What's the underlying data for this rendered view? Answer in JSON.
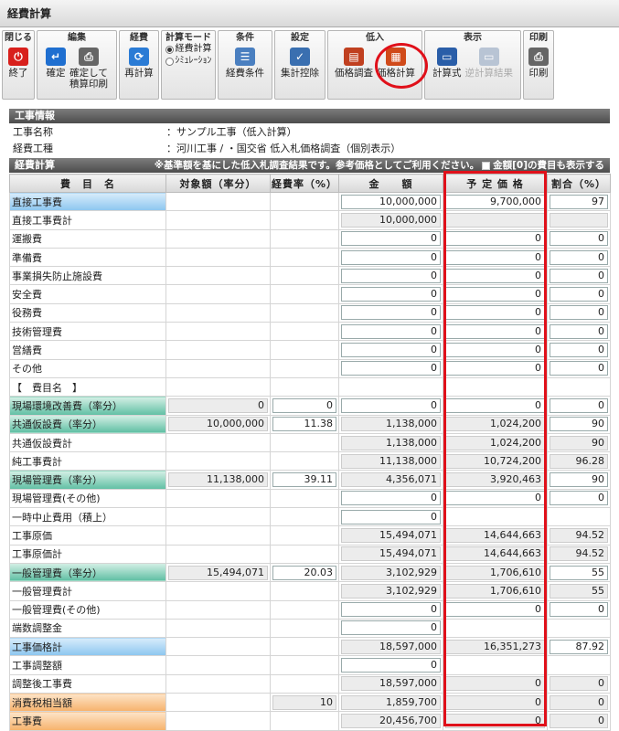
{
  "window": {
    "title": "経費計算"
  },
  "toolbar": {
    "groups": [
      {
        "id": "close",
        "title": "閉じる",
        "buttons": [
          {
            "id": "exit",
            "label": "終了",
            "icon": "power-icon",
            "color": "#d8201c",
            "enabled": true
          }
        ]
      },
      {
        "id": "edit",
        "title": "編集",
        "buttons": [
          {
            "id": "confirm",
            "label": "確定",
            "icon": "enter-arrow-icon",
            "color": "#1f6fd0",
            "enabled": true
          },
          {
            "id": "confirm-print",
            "label": "確定して\n積算印刷",
            "icon": "printer-icon",
            "color": "#666666",
            "enabled": true
          }
        ]
      },
      {
        "id": "expense",
        "title": "経費",
        "buttons": [
          {
            "id": "recalc",
            "label": "再計算",
            "icon": "refresh-icon",
            "color": "#2a7bd5",
            "enabled": true
          }
        ]
      },
      {
        "id": "mode",
        "title": "計算モード",
        "radios": [
          {
            "id": "mode-calc",
            "label": "経費計算",
            "selected": true
          },
          {
            "id": "mode-sim",
            "label": "ｼﾐｭﾚｰｼｮﾝ",
            "selected": false
          }
        ]
      },
      {
        "id": "conditions",
        "title": "条件",
        "buttons": [
          {
            "id": "expense-conditions",
            "label": "経費条件",
            "icon": "list-icon",
            "color": "#4a7fc0",
            "enabled": true
          }
        ]
      },
      {
        "id": "settings",
        "title": "設定",
        "buttons": [
          {
            "id": "aggregation-deduction",
            "label": "集計控除",
            "icon": "calendar-check-icon",
            "color": "#3a6fb0",
            "enabled": true
          }
        ]
      },
      {
        "id": "low-bid",
        "title": "低入",
        "buttons": [
          {
            "id": "price-survey",
            "label": "価格調査",
            "icon": "book-icon",
            "color": "#c04020",
            "enabled": true
          },
          {
            "id": "price-calc",
            "label": "価格計算",
            "icon": "calculator-icon",
            "color": "#d04a1a",
            "enabled": true
          }
        ]
      },
      {
        "id": "display",
        "title": "表示",
        "buttons": [
          {
            "id": "formula",
            "label": "計算式",
            "icon": "window-icon",
            "color": "#2a5ea8",
            "enabled": true
          },
          {
            "id": "reverse-result",
            "label": "逆計算結果",
            "icon": "window-icon",
            "color": "#b8c4d4",
            "enabled": false
          }
        ]
      },
      {
        "id": "print",
        "title": "印刷",
        "buttons": [
          {
            "id": "print",
            "label": "印刷",
            "icon": "printer-icon",
            "color": "#666666",
            "enabled": true
          }
        ]
      }
    ]
  },
  "info": {
    "section_title": "工事情報",
    "rows": [
      {
        "label": "工事名称",
        "value": "：サンプル工事（低入計算）"
      },
      {
        "label": "経費工種",
        "value": "：河川工事 / ・国交省 低入札価格調査（個別表示）"
      }
    ]
  },
  "calc": {
    "section_title": "経費計算",
    "note": "※基準額を基にした低入札調査結果です。参考価格としてご利用ください。",
    "checkbox_label": "金額[0]の費目も表示する",
    "headers": [
      "費　目　名",
      "対象額（率分）",
      "経費率（%）",
      "金　　額",
      "予 定 価 格",
      "割合（%）"
    ],
    "rows": [
      {
        "name": "直接工事費",
        "color": "blue",
        "target": "",
        "rate": "",
        "amount": "10,000,000",
        "amount_ro": false,
        "planned": "9,700,000",
        "planned_ro": false,
        "ratio": "97",
        "ratio_ro": false
      },
      {
        "name": "直接工事費計",
        "color": "",
        "target": "",
        "rate": "",
        "amount": "10,000,000",
        "amount_ro": true,
        "planned": "",
        "planned_ro": true,
        "ratio": "",
        "ratio_ro": true
      },
      {
        "name": "運搬費",
        "color": "",
        "target": "",
        "rate": "",
        "amount": "0",
        "amount_ro": false,
        "planned": "0",
        "planned_ro": false,
        "ratio": "0",
        "ratio_ro": false
      },
      {
        "name": "準備費",
        "color": "",
        "target": "",
        "rate": "",
        "amount": "0",
        "amount_ro": false,
        "planned": "0",
        "planned_ro": false,
        "ratio": "0",
        "ratio_ro": false
      },
      {
        "name": "事業損失防止施設費",
        "color": "",
        "target": "",
        "rate": "",
        "amount": "0",
        "amount_ro": false,
        "planned": "0",
        "planned_ro": false,
        "ratio": "0",
        "ratio_ro": false
      },
      {
        "name": "安全費",
        "color": "",
        "target": "",
        "rate": "",
        "amount": "0",
        "amount_ro": false,
        "planned": "0",
        "planned_ro": false,
        "ratio": "0",
        "ratio_ro": false
      },
      {
        "name": "役務費",
        "color": "",
        "target": "",
        "rate": "",
        "amount": "0",
        "amount_ro": false,
        "planned": "0",
        "planned_ro": false,
        "ratio": "0",
        "ratio_ro": false
      },
      {
        "name": "技術管理費",
        "color": "",
        "target": "",
        "rate": "",
        "amount": "0",
        "amount_ro": false,
        "planned": "0",
        "planned_ro": false,
        "ratio": "0",
        "ratio_ro": false
      },
      {
        "name": "営繕費",
        "color": "",
        "target": "",
        "rate": "",
        "amount": "0",
        "amount_ro": false,
        "planned": "0",
        "planned_ro": false,
        "ratio": "0",
        "ratio_ro": false
      },
      {
        "name": "その他",
        "color": "",
        "target": "",
        "rate": "",
        "amount": "0",
        "amount_ro": false,
        "planned": "0",
        "planned_ro": false,
        "ratio": "0",
        "ratio_ro": false
      },
      {
        "name": "【　費目名　】",
        "color": "",
        "target": "",
        "rate": "",
        "amount": "",
        "amount_ro": null,
        "planned": "",
        "planned_ro": null,
        "ratio": "",
        "ratio_ro": null
      },
      {
        "name": "現場環境改善費（率分）",
        "color": "teal",
        "target": "0",
        "target_ro": true,
        "rate": "0",
        "rate_ro": false,
        "amount": "0",
        "amount_ro": false,
        "planned": "0",
        "planned_ro": false,
        "ratio": "0",
        "ratio_ro": false
      },
      {
        "name": "共通仮設費（率分）",
        "color": "teal",
        "target": "10,000,000",
        "target_ro": true,
        "rate": "11.38",
        "rate_ro": false,
        "amount": "1,138,000",
        "amount_ro": true,
        "planned": "1,024,200",
        "planned_ro": true,
        "ratio": "90",
        "ratio_ro": false
      },
      {
        "name": "共通仮設費計",
        "color": "",
        "target": "",
        "rate": "",
        "amount": "1,138,000",
        "amount_ro": true,
        "planned": "1,024,200",
        "planned_ro": true,
        "ratio": "90",
        "ratio_ro": true
      },
      {
        "name": "純工事費計",
        "color": "",
        "target": "",
        "rate": "",
        "amount": "11,138,000",
        "amount_ro": true,
        "planned": "10,724,200",
        "planned_ro": true,
        "ratio": "96.28",
        "ratio_ro": true
      },
      {
        "name": "現場管理費（率分）",
        "color": "teal",
        "target": "11,138,000",
        "target_ro": true,
        "rate": "39.11",
        "rate_ro": false,
        "amount": "4,356,071",
        "amount_ro": true,
        "planned": "3,920,463",
        "planned_ro": true,
        "ratio": "90",
        "ratio_ro": false
      },
      {
        "name": "現場管理費(その他)",
        "color": "",
        "target": "",
        "rate": "",
        "amount": "0",
        "amount_ro": false,
        "planned": "0",
        "planned_ro": false,
        "ratio": "0",
        "ratio_ro": false
      },
      {
        "name": "一時中止費用（積上）",
        "color": "",
        "target": "",
        "rate": "",
        "amount": "0",
        "amount_ro": false,
        "planned": "",
        "planned_ro": null,
        "ratio": "",
        "ratio_ro": null
      },
      {
        "name": "工事原価",
        "color": "",
        "target": "",
        "rate": "",
        "amount": "15,494,071",
        "amount_ro": true,
        "planned": "14,644,663",
        "planned_ro": true,
        "ratio": "94.52",
        "ratio_ro": true
      },
      {
        "name": "工事原価計",
        "color": "",
        "target": "",
        "rate": "",
        "amount": "15,494,071",
        "amount_ro": true,
        "planned": "14,644,663",
        "planned_ro": true,
        "ratio": "94.52",
        "ratio_ro": true
      },
      {
        "name": "一般管理費（率分）",
        "color": "teal",
        "target": "15,494,071",
        "target_ro": true,
        "rate": "20.03",
        "rate_ro": false,
        "amount": "3,102,929",
        "amount_ro": true,
        "planned": "1,706,610",
        "planned_ro": true,
        "ratio": "55",
        "ratio_ro": false
      },
      {
        "name": "一般管理費計",
        "color": "",
        "target": "",
        "rate": "",
        "amount": "3,102,929",
        "amount_ro": true,
        "planned": "1,706,610",
        "planned_ro": true,
        "ratio": "55",
        "ratio_ro": true
      },
      {
        "name": "一般管理費(その他)",
        "color": "",
        "target": "",
        "rate": "",
        "amount": "0",
        "amount_ro": false,
        "planned": "0",
        "planned_ro": false,
        "ratio": "0",
        "ratio_ro": false
      },
      {
        "name": "端数調整金",
        "color": "",
        "target": "",
        "rate": "",
        "amount": "0",
        "amount_ro": false,
        "planned": "",
        "planned_ro": null,
        "ratio": "",
        "ratio_ro": null
      },
      {
        "name": "工事価格計",
        "color": "blue",
        "target": "",
        "rate": "",
        "amount": "18,597,000",
        "amount_ro": true,
        "planned": "16,351,273",
        "planned_ro": true,
        "ratio": "87.92",
        "ratio_ro": false
      },
      {
        "name": "工事調整額",
        "color": "",
        "target": "",
        "rate": "",
        "amount": "0",
        "amount_ro": false,
        "planned": "",
        "planned_ro": null,
        "ratio": "",
        "ratio_ro": null
      },
      {
        "name": "調整後工事費",
        "color": "",
        "target": "",
        "rate": "",
        "amount": "18,597,000",
        "amount_ro": true,
        "planned": "0",
        "planned_ro": true,
        "ratio": "0",
        "ratio_ro": true
      },
      {
        "name": "消費税相当額",
        "color": "orange",
        "target": "",
        "rate": "10",
        "rate_ro": true,
        "amount": "1,859,700",
        "amount_ro": true,
        "planned": "0",
        "planned_ro": true,
        "ratio": "0",
        "ratio_ro": true
      },
      {
        "name": "工事費",
        "color": "orange",
        "target": "",
        "rate": "",
        "amount": "20,456,700",
        "amount_ro": true,
        "planned": "0",
        "planned_ro": true,
        "ratio": "0",
        "ratio_ro": true
      }
    ]
  }
}
